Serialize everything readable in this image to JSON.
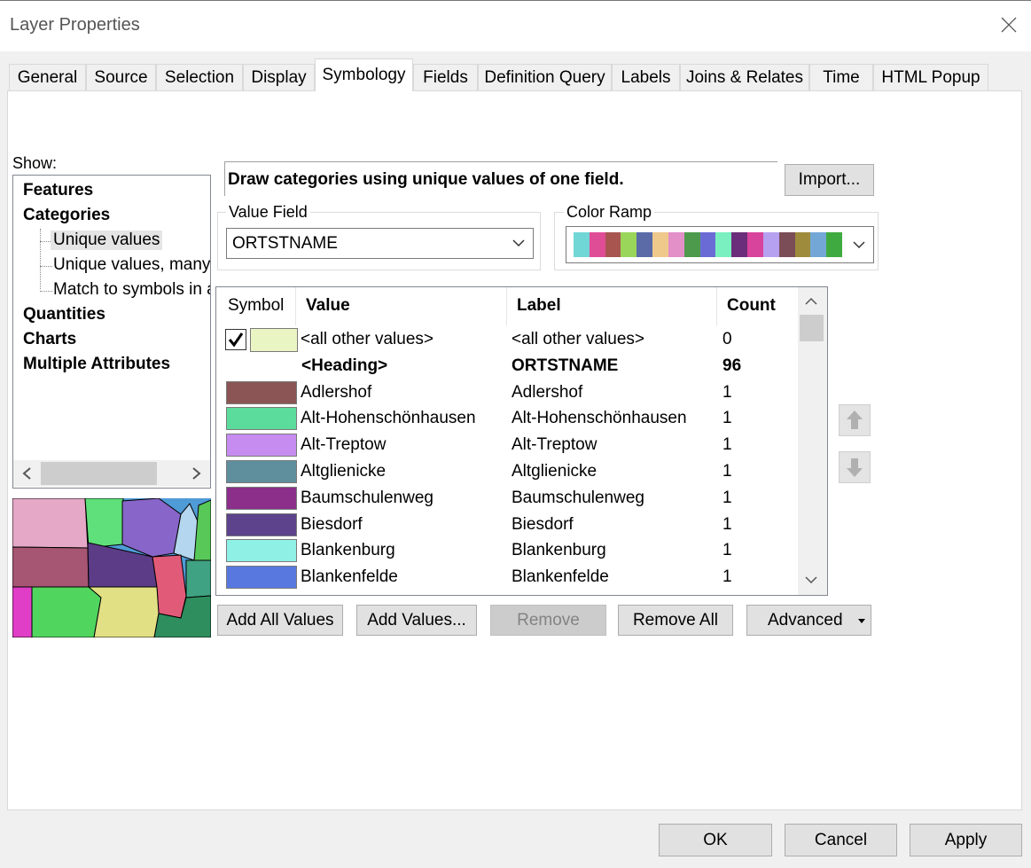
{
  "window": {
    "title": "Layer Properties"
  },
  "tabs": [
    {
      "label": "General"
    },
    {
      "label": "Source"
    },
    {
      "label": "Selection"
    },
    {
      "label": "Display"
    },
    {
      "label": "Symbology"
    },
    {
      "label": "Fields"
    },
    {
      "label": "Definition Query"
    },
    {
      "label": "Labels"
    },
    {
      "label": "Joins & Relates"
    },
    {
      "label": "Time"
    },
    {
      "label": "HTML Popup"
    }
  ],
  "active_tab": "Symbology",
  "show": {
    "label": "Show:",
    "items": [
      {
        "label": "Features"
      },
      {
        "label": "Categories"
      },
      {
        "label": "Unique values"
      },
      {
        "label": "Unique values, many"
      },
      {
        "label": "Match to symbols in a"
      },
      {
        "label": "Quantities"
      },
      {
        "label": "Charts"
      },
      {
        "label": "Multiple Attributes"
      }
    ]
  },
  "description": "Draw categories using unique values of one field.",
  "import_label": "Import...",
  "value_field": {
    "label": "Value Field",
    "value": "ORTSTNAME"
  },
  "color_ramp": {
    "label": "Color Ramp",
    "colors": [
      "#70d6d6",
      "#e04d97",
      "#a8554f",
      "#9ad65a",
      "#5a6ba8",
      "#efc98c",
      "#e38fc8",
      "#4d9a4d",
      "#6b6bd6",
      "#7af0c0",
      "#6b2e7a",
      "#d8439c",
      "#b6a1f0",
      "#7a4d57",
      "#9e8c3c",
      "#73a8d6",
      "#3faa3f"
    ]
  },
  "table": {
    "headers": {
      "symbol": "Symbol",
      "value": "Value",
      "label": "Label",
      "count": "Count"
    },
    "rows": [
      {
        "value": "<all other values>",
        "label": "<all other values>",
        "count": "0",
        "color": "#eaf5c4",
        "checked": true
      },
      {
        "value": "<Heading>",
        "label": "ORTSTNAME",
        "count": "96",
        "heading": true
      },
      {
        "value": "Adlershof",
        "label": "Adlershof",
        "count": "1",
        "color": "#8c5555"
      },
      {
        "value": "Alt-Hohenschönhausen",
        "label": "Alt-Hohenschönhausen",
        "count": "1",
        "color": "#5cdc9c"
      },
      {
        "value": "Alt-Treptow",
        "label": "Alt-Treptow",
        "count": "1",
        "color": "#c68cf0"
      },
      {
        "value": "Altglienicke",
        "label": "Altglienicke",
        "count": "1",
        "color": "#5f8e9d"
      },
      {
        "value": "Baumschulenweg",
        "label": "Baumschulenweg",
        "count": "1",
        "color": "#8b2f8b"
      },
      {
        "value": "Biesdorf",
        "label": "Biesdorf",
        "count": "1",
        "color": "#5c438c"
      },
      {
        "value": "Blankenburg",
        "label": "Blankenburg",
        "count": "1",
        "color": "#8ff0e6"
      },
      {
        "value": "Blankenfelde",
        "label": "Blankenfelde",
        "count": "1",
        "color": "#5878e0"
      }
    ]
  },
  "buttons": {
    "add_all": "Add All Values",
    "add_values": "Add Values...",
    "remove": "Remove",
    "remove_all": "Remove All",
    "advanced": "Advanced",
    "ok": "OK",
    "cancel": "Cancel",
    "apply": "Apply"
  }
}
